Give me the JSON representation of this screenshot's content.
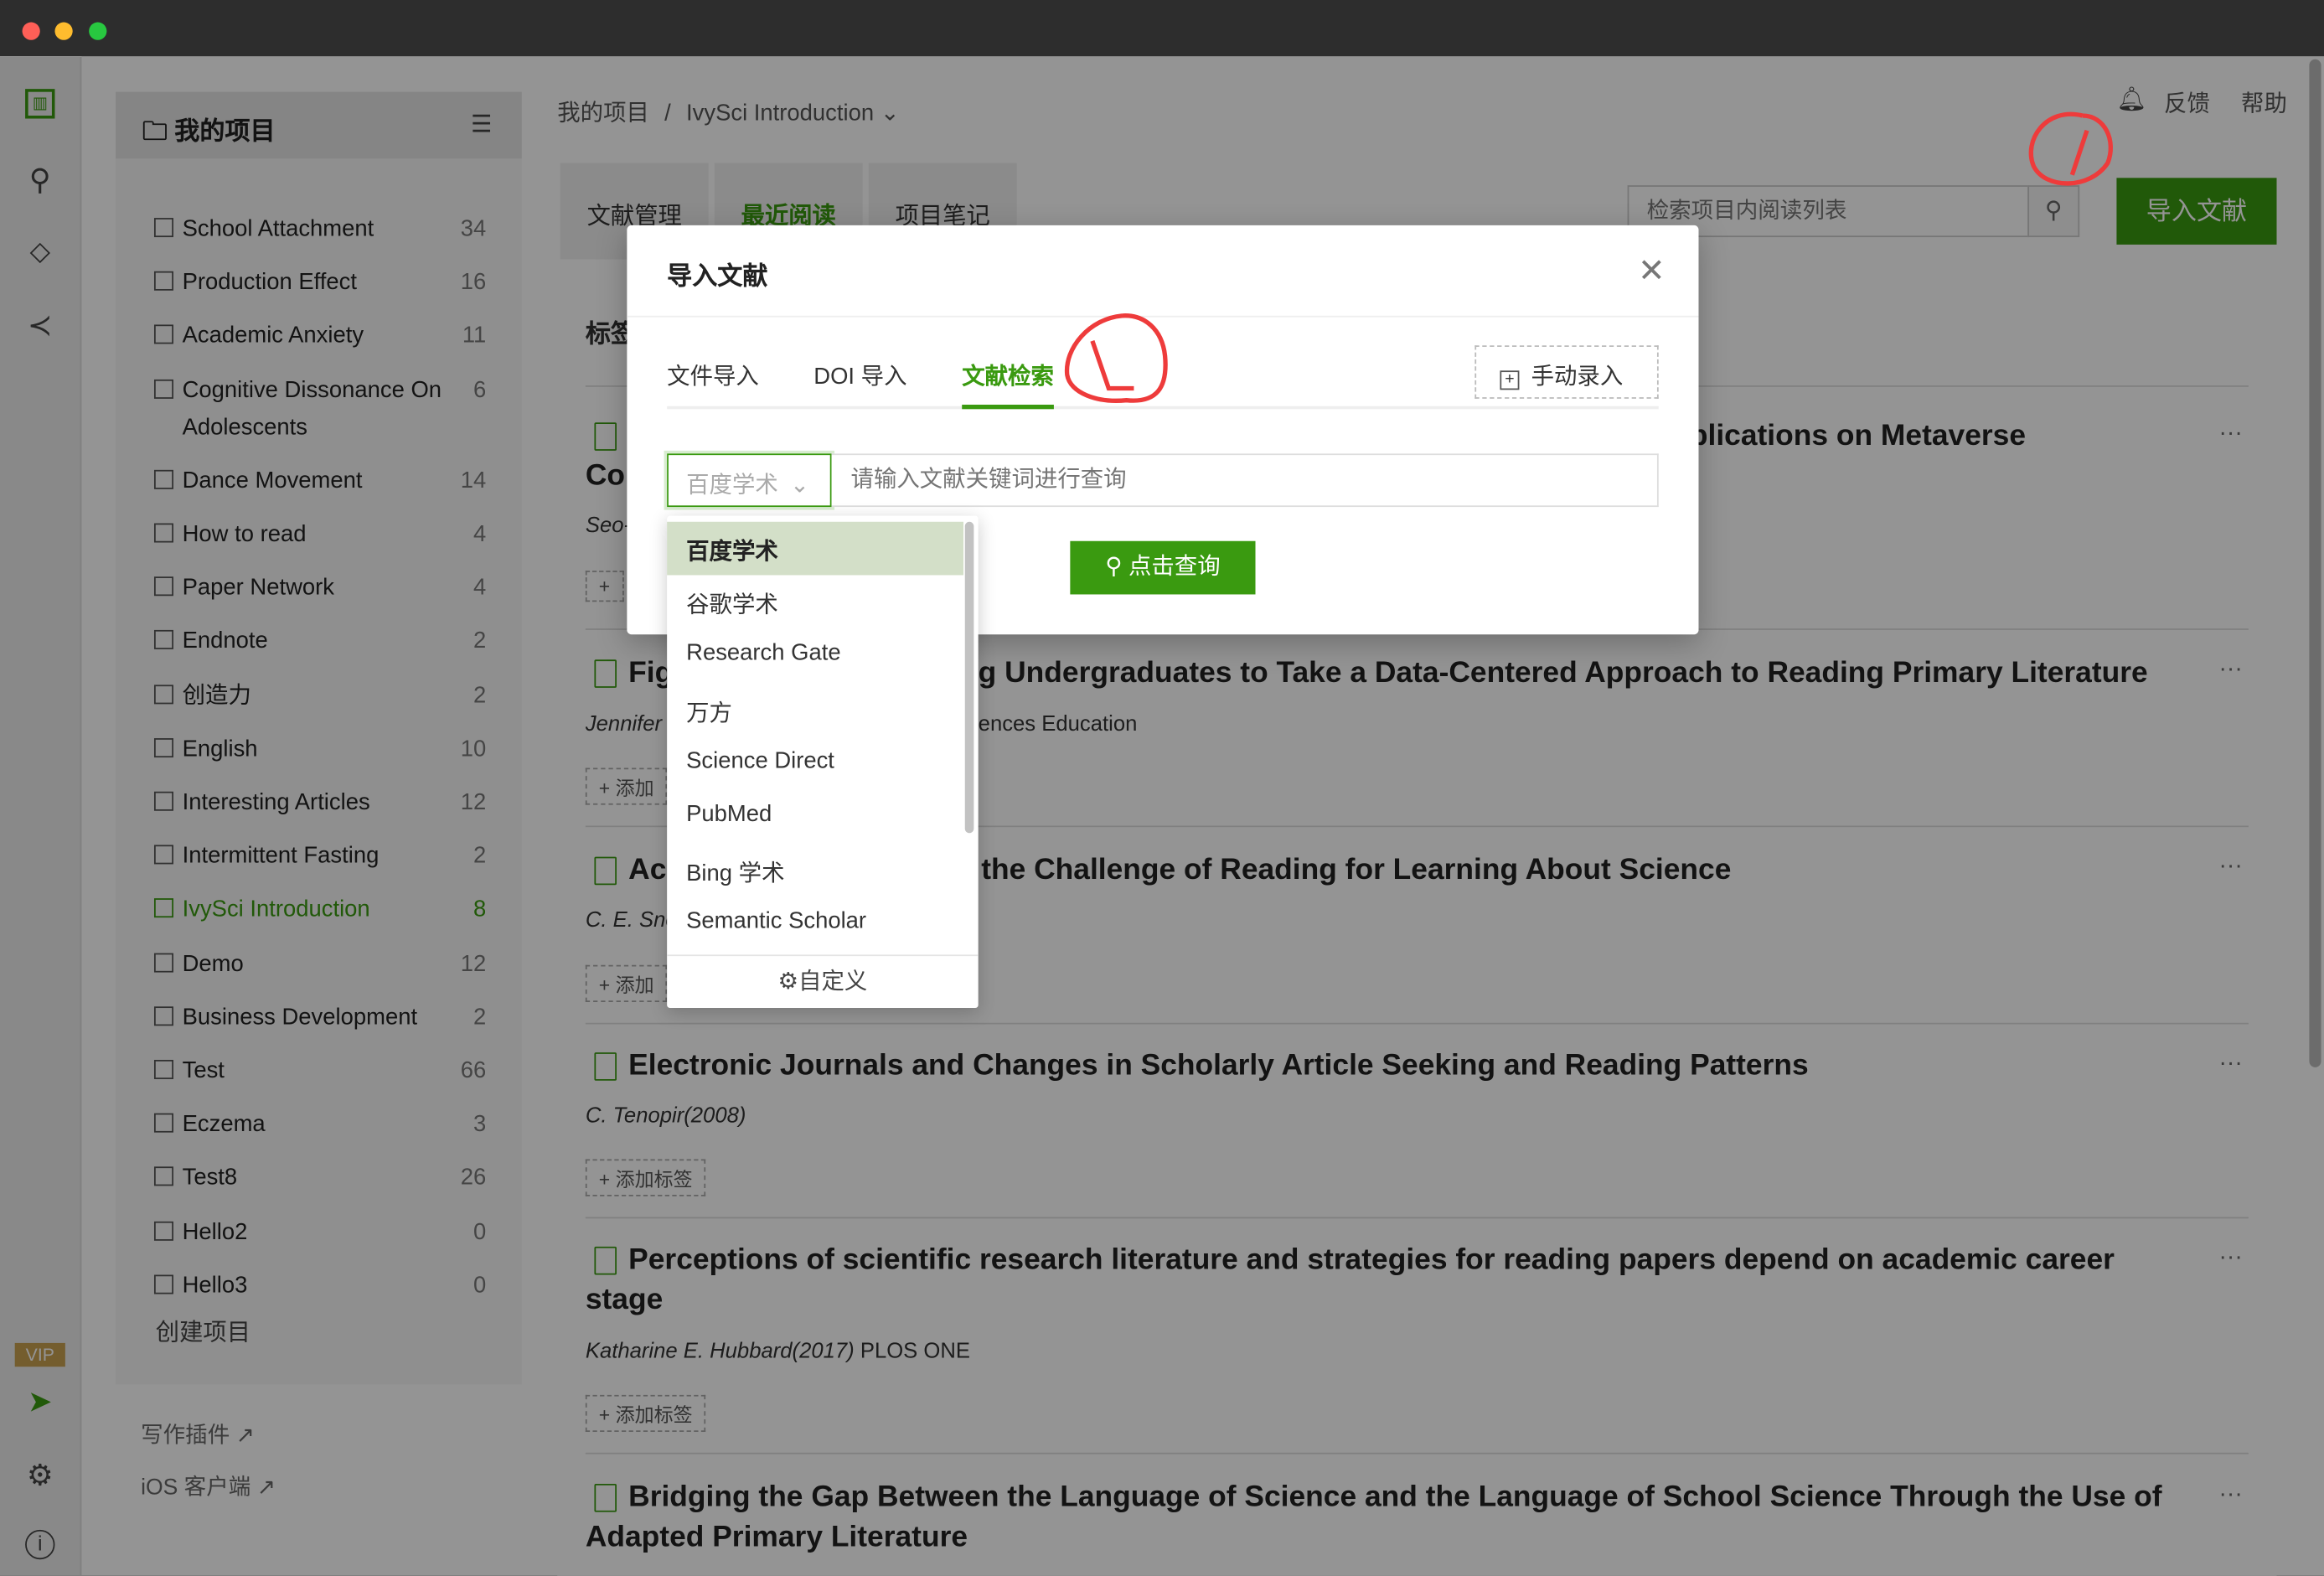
{
  "window": {
    "traffic_lights": [
      "#fe5f57",
      "#febc2e",
      "#28c840"
    ]
  },
  "colors": {
    "accent": "#3a9a10",
    "annotation": "#ee3b3b"
  },
  "left_rail": {
    "icons": [
      "board-icon",
      "search-icon",
      "tag-icon",
      "share-icon",
      "vip-icon",
      "paper-plane-icon",
      "gear-icon",
      "info-icon"
    ],
    "vip_label": "VIP"
  },
  "projects": {
    "title": "我的项目",
    "items": [
      {
        "label": "School Attachment",
        "count": "34"
      },
      {
        "label": "Production Effect",
        "count": "16"
      },
      {
        "label": "Academic Anxiety",
        "count": "11"
      },
      {
        "label": "Cognitive Dissonance On Adolescents",
        "count": "6"
      },
      {
        "label": "Dance Movement",
        "count": "14"
      },
      {
        "label": "How to read",
        "count": "4"
      },
      {
        "label": "Paper Network",
        "count": "4"
      },
      {
        "label": "Endnote",
        "count": "2"
      },
      {
        "label": "创造力",
        "count": "2"
      },
      {
        "label": "English",
        "count": "10"
      },
      {
        "label": "Interesting Articles",
        "count": "12"
      },
      {
        "label": "Intermittent Fasting",
        "count": "2"
      },
      {
        "label": "IvySci Introduction",
        "count": "8",
        "active": true
      },
      {
        "label": "Demo",
        "count": "12"
      },
      {
        "label": "Business Development",
        "count": "2"
      },
      {
        "label": "Test",
        "count": "66"
      },
      {
        "label": "Eczema",
        "count": "3"
      },
      {
        "label": "Test8",
        "count": "26"
      },
      {
        "label": "Hello2",
        "count": "0"
      },
      {
        "label": "Hello3",
        "count": "0"
      }
    ],
    "create": "创建项目",
    "writing_plugin": "写作插件",
    "ios_client": "iOS 客户端"
  },
  "header": {
    "breadcrumb_root": "我的项目",
    "breadcrumb_sep": "/",
    "breadcrumb_current": "IvySci Introduction",
    "feedback": "反馈",
    "help": "帮助"
  },
  "tabs": [
    {
      "label": "文献管理"
    },
    {
      "label": "最近阅读",
      "active": true
    },
    {
      "label": "项目笔记"
    }
  ],
  "search": {
    "placeholder": "检索项目内阅读列表"
  },
  "import_button": "导入文献",
  "tags_heading": "标签",
  "articles": [
    {
      "title_a": "Co",
      "title_b": "plications on Metaverse",
      "author": "Seo-",
      "tag": "+"
    },
    {
      "title_a": "Fig",
      "title_b": "g Undergraduates to Take a Data-Centered Approach to Reading Primary Literature",
      "author": "Jennifer",
      "venue": "ences Education",
      "tag": "+ 添加"
    },
    {
      "title_a": "Ac",
      "title_b": "the Challenge of Reading for Learning About Science",
      "author": "C. E. Sno",
      "tag": "+ 添加"
    },
    {
      "title": "Electronic Journals and Changes in Scholarly Article Seeking and Reading Patterns",
      "author": "C. Tenopir(2008)",
      "tag": "+ 添加标签"
    },
    {
      "title": "Perceptions of scientific research literature and strategies for reading papers depend on academic career",
      "title2": "stage",
      "author": "Katharine E. Hubbard(2017)",
      "venue": "PLOS ONE",
      "tag": "+ 添加标签"
    },
    {
      "title": "Bridging the Gap Between the Language of Science and the Language of School Science Through the Use of",
      "title2": "Adapted Primary Literature"
    }
  ],
  "more_label": "···",
  "modal": {
    "title": "导入文献",
    "tabs": [
      {
        "label": "文件导入"
      },
      {
        "label": "DOI 导入"
      },
      {
        "label": "文献检索",
        "active": true
      }
    ],
    "manual_entry": "手动录入",
    "source_selected": "百度学术",
    "query_placeholder": "请输入文献关键词进行查询",
    "search_button": "点击查询",
    "sources": [
      "百度学术",
      "谷歌学术",
      "Research Gate",
      "万方",
      "Science Direct",
      "PubMed",
      "Bing 学术",
      "Semantic Scholar"
    ],
    "customize": "自定义"
  }
}
